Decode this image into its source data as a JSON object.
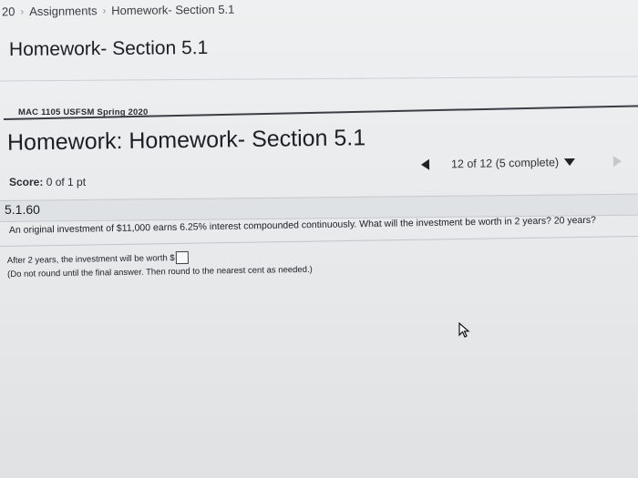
{
  "breadcrumb": {
    "prefix": "20",
    "assignments": "Assignments",
    "current": "Homework- Section 5.1"
  },
  "page": {
    "title": "Homework- Section 5.1"
  },
  "course": {
    "name": "MAC 1105 USFSM Spring 2020"
  },
  "homework": {
    "title": "Homework: Homework- Section 5.1"
  },
  "score": {
    "label": "Score:",
    "value": "0 of 1 pt"
  },
  "navigation": {
    "progress": "12 of 12 (5 complete)"
  },
  "question": {
    "number": "5.1.60",
    "text": "An original investment of $11,000 earns 6.25% interest compounded continuously. What will the investment be worth in 2 years? 20 years?",
    "answer_prompt": "After 2 years, the investment will be worth $",
    "answer_value": "",
    "note": "(Do not round until the final answer. Then round to the nearest cent as needed.)"
  }
}
